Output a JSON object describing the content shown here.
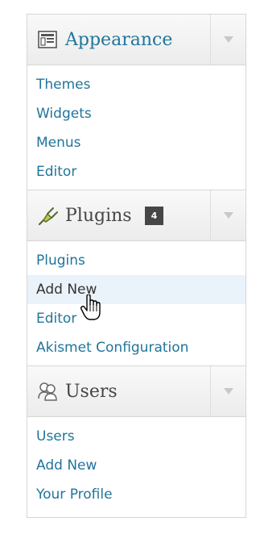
{
  "menu": {
    "appearance": {
      "title": "Appearance",
      "icon": "appearance-icon",
      "items": [
        "Themes",
        "Widgets",
        "Menus",
        "Editor"
      ]
    },
    "plugins": {
      "title": "Plugins",
      "icon": "plugin-plug-icon",
      "badge": "4",
      "items": [
        "Plugins",
        "Add New",
        "Editor",
        "Akismet Configuration"
      ]
    },
    "users": {
      "title": "Users",
      "icon": "users-icon",
      "items": [
        "Users",
        "Add New",
        "Your Profile"
      ]
    }
  },
  "colors": {
    "link": "#21759b",
    "text_dark": "#333333",
    "hover_bg": "#eaf2fa",
    "badge_bg": "#464646"
  }
}
